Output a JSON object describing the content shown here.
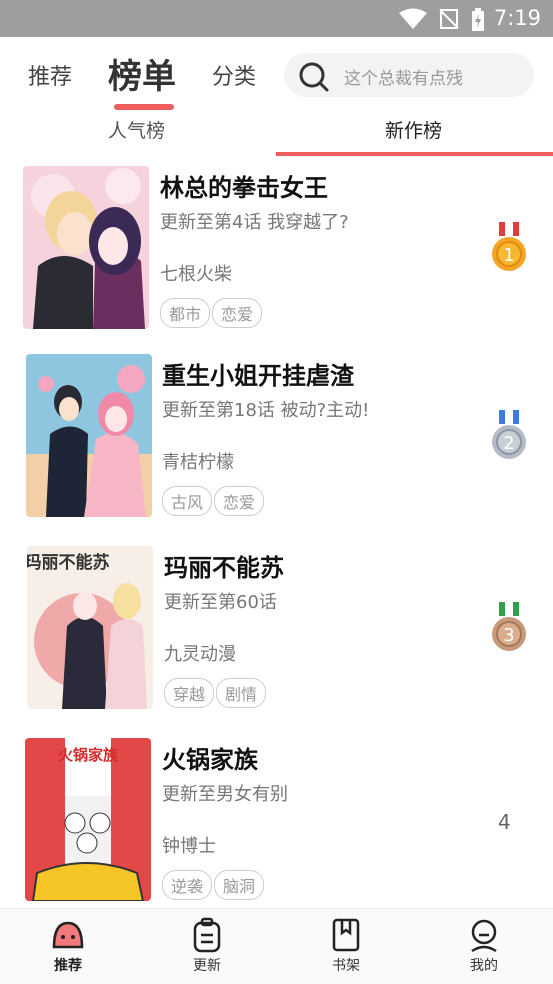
{
  "status_bar": {
    "time": "7:19"
  },
  "top_nav": {
    "tabs": [
      "推荐",
      "榜单",
      "分类"
    ],
    "active": "榜单",
    "search_placeholder": "这个总裁有点残"
  },
  "sub_tabs": {
    "items": [
      "人气榜",
      "新作榜"
    ],
    "active": "新作榜"
  },
  "list": [
    {
      "title": "林总的拳击女王",
      "update": "更新至第4话 我穿越了?",
      "author": "七根火柴",
      "tags": [
        "都市",
        "恋爱"
      ],
      "rank": "1"
    },
    {
      "title": "重生小姐开挂虐渣",
      "update": "更新至第18话 被动?主动!",
      "author": "青桔柠檬",
      "tags": [
        "古风",
        "恋爱"
      ],
      "rank": "2"
    },
    {
      "title": "玛丽不能苏",
      "update": "更新至第60话",
      "author": "九灵动漫",
      "tags": [
        "穿越",
        "剧情"
      ],
      "rank": "3"
    },
    {
      "title": "火锅家族",
      "update": "更新至男女有别",
      "author": "钟博士",
      "tags": [
        "逆袭",
        "脑洞"
      ],
      "rank": "4"
    }
  ],
  "cover_texts": {
    "book3": "玛丽不能苏",
    "book4": "火锅家族"
  },
  "bottom_nav": {
    "items": [
      "推荐",
      "更新",
      "书架",
      "我的"
    ],
    "active": "推荐"
  },
  "colors": {
    "accent": "#f05d5d",
    "gold": "#f5a623",
    "silver": "#b5bcc6",
    "bronze": "#c99a7a"
  }
}
